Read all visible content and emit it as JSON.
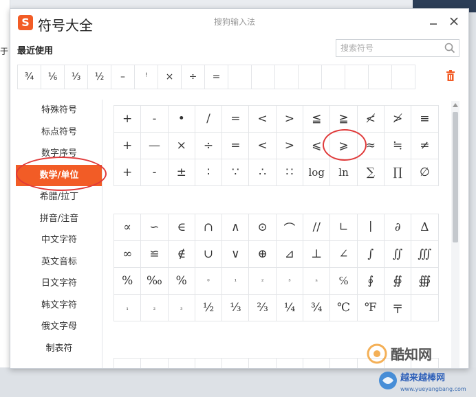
{
  "background": {
    "left_fragment": "于"
  },
  "window": {
    "title": "符号大全",
    "app_name": "搜狗输入法",
    "logo_letter": "S",
    "minimize_label": "—",
    "close_label": "✕",
    "accent_color": "#f25c26"
  },
  "recent": {
    "label": "最近使用",
    "items": [
      "¾",
      "⅙",
      "⅓",
      "½",
      "–",
      "ꜝ",
      "×",
      "÷",
      "=",
      "",
      "",
      "",
      "",
      "",
      "",
      "",
      ""
    ]
  },
  "search": {
    "placeholder": "搜索符号",
    "icon": "search-icon"
  },
  "sidebar": {
    "items": [
      {
        "label": "特殊符号",
        "active": false
      },
      {
        "label": "标点符号",
        "active": false
      },
      {
        "label": "数字序号",
        "active": false
      },
      {
        "label": "数学/单位",
        "active": true
      },
      {
        "label": "希腊/拉丁",
        "active": false
      },
      {
        "label": "拼音/注音",
        "active": false
      },
      {
        "label": "中文字符",
        "active": false
      },
      {
        "label": "英文音标",
        "active": false
      },
      {
        "label": "日文字符",
        "active": false
      },
      {
        "label": "韩文字符",
        "active": false
      },
      {
        "label": "俄文字母",
        "active": false
      },
      {
        "label": "制表符",
        "active": false
      }
    ]
  },
  "symbols": {
    "section1": [
      "+",
      "-",
      "•",
      "/",
      "=",
      "<",
      ">",
      "≦",
      "≧",
      "≮",
      "≯",
      "≡",
      "+",
      "—",
      "×",
      "÷",
      "=",
      "<",
      ">",
      "⩽",
      "⩾",
      "≈",
      "≒",
      "≠",
      "+",
      "-",
      "±",
      "∶",
      "∵",
      "∴",
      "∷",
      "log",
      "ln",
      "∑",
      "∏",
      "∅"
    ],
    "section2": [
      "∝",
      "∽",
      "∈",
      "∩",
      "∧",
      "⊙",
      "⌒",
      "//",
      "∟",
      "∣",
      "∂",
      "Δ",
      "∞",
      "≌",
      "∉",
      "∪",
      "∨",
      "⊕",
      "⊿",
      "⊥",
      "∠",
      "∫",
      "∬",
      "∭",
      "%",
      "‰",
      "%",
      "⁰",
      "¹",
      "²",
      "³",
      "ⁿ",
      "℅",
      "∮",
      "∯",
      "∰",
      "₁",
      "₂",
      "₃",
      "½",
      "⅓",
      "⅔",
      "¼",
      "¾",
      "℃",
      "℉",
      "〒",
      ""
    ],
    "section3": [
      "",
      "",
      "",
      "",
      "",
      "",
      "",
      "",
      "",
      "",
      "",
      ""
    ]
  },
  "watermarks": {
    "brand1": "酷知网",
    "brand2": "越来越棒网",
    "url": "www.yueyangbang.com"
  },
  "annotation_color": "#e03a3a"
}
